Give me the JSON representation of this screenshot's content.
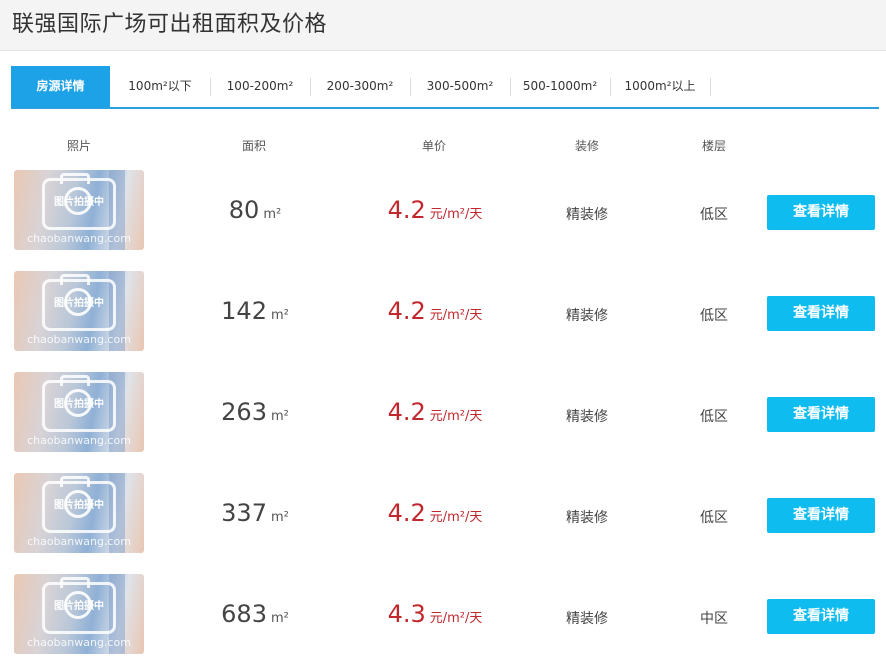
{
  "page": {
    "title": "联强国际广场可出租面积及价格"
  },
  "tabs": [
    {
      "label": "房源详情",
      "active": true
    },
    {
      "label": "100m²以下"
    },
    {
      "label": "100-200m²"
    },
    {
      "label": "200-300m²"
    },
    {
      "label": "300-500m²"
    },
    {
      "label": "500-1000m²"
    },
    {
      "label": "1000m²以上"
    }
  ],
  "columns": {
    "photo": "照片",
    "area": "面积",
    "price": "单价",
    "decoration": "装修",
    "floor": "楼层"
  },
  "photo_placeholder": {
    "text": "图片拍摄中",
    "watermark": "chaobanwang.com"
  },
  "listings": [
    {
      "area": "80",
      "area_unit": "m²",
      "price": "4.2",
      "price_unit": "元/m²/天",
      "decoration": "精装修",
      "floor": "低区",
      "button": "查看详情"
    },
    {
      "area": "142",
      "area_unit": "m²",
      "price": "4.2",
      "price_unit": "元/m²/天",
      "decoration": "精装修",
      "floor": "低区",
      "button": "查看详情"
    },
    {
      "area": "263",
      "area_unit": "m²",
      "price": "4.2",
      "price_unit": "元/m²/天",
      "decoration": "精装修",
      "floor": "低区",
      "button": "查看详情"
    },
    {
      "area": "337",
      "area_unit": "m²",
      "price": "4.2",
      "price_unit": "元/m²/天",
      "decoration": "精装修",
      "floor": "低区",
      "button": "查看详情"
    },
    {
      "area": "683",
      "area_unit": "m²",
      "price": "4.3",
      "price_unit": "元/m²/天",
      "decoration": "精装修",
      "floor": "中区",
      "button": "查看详情"
    }
  ],
  "colors": {
    "accent": "#1ea2e7",
    "button": "#0fbcf0",
    "price": "#c0282d"
  }
}
